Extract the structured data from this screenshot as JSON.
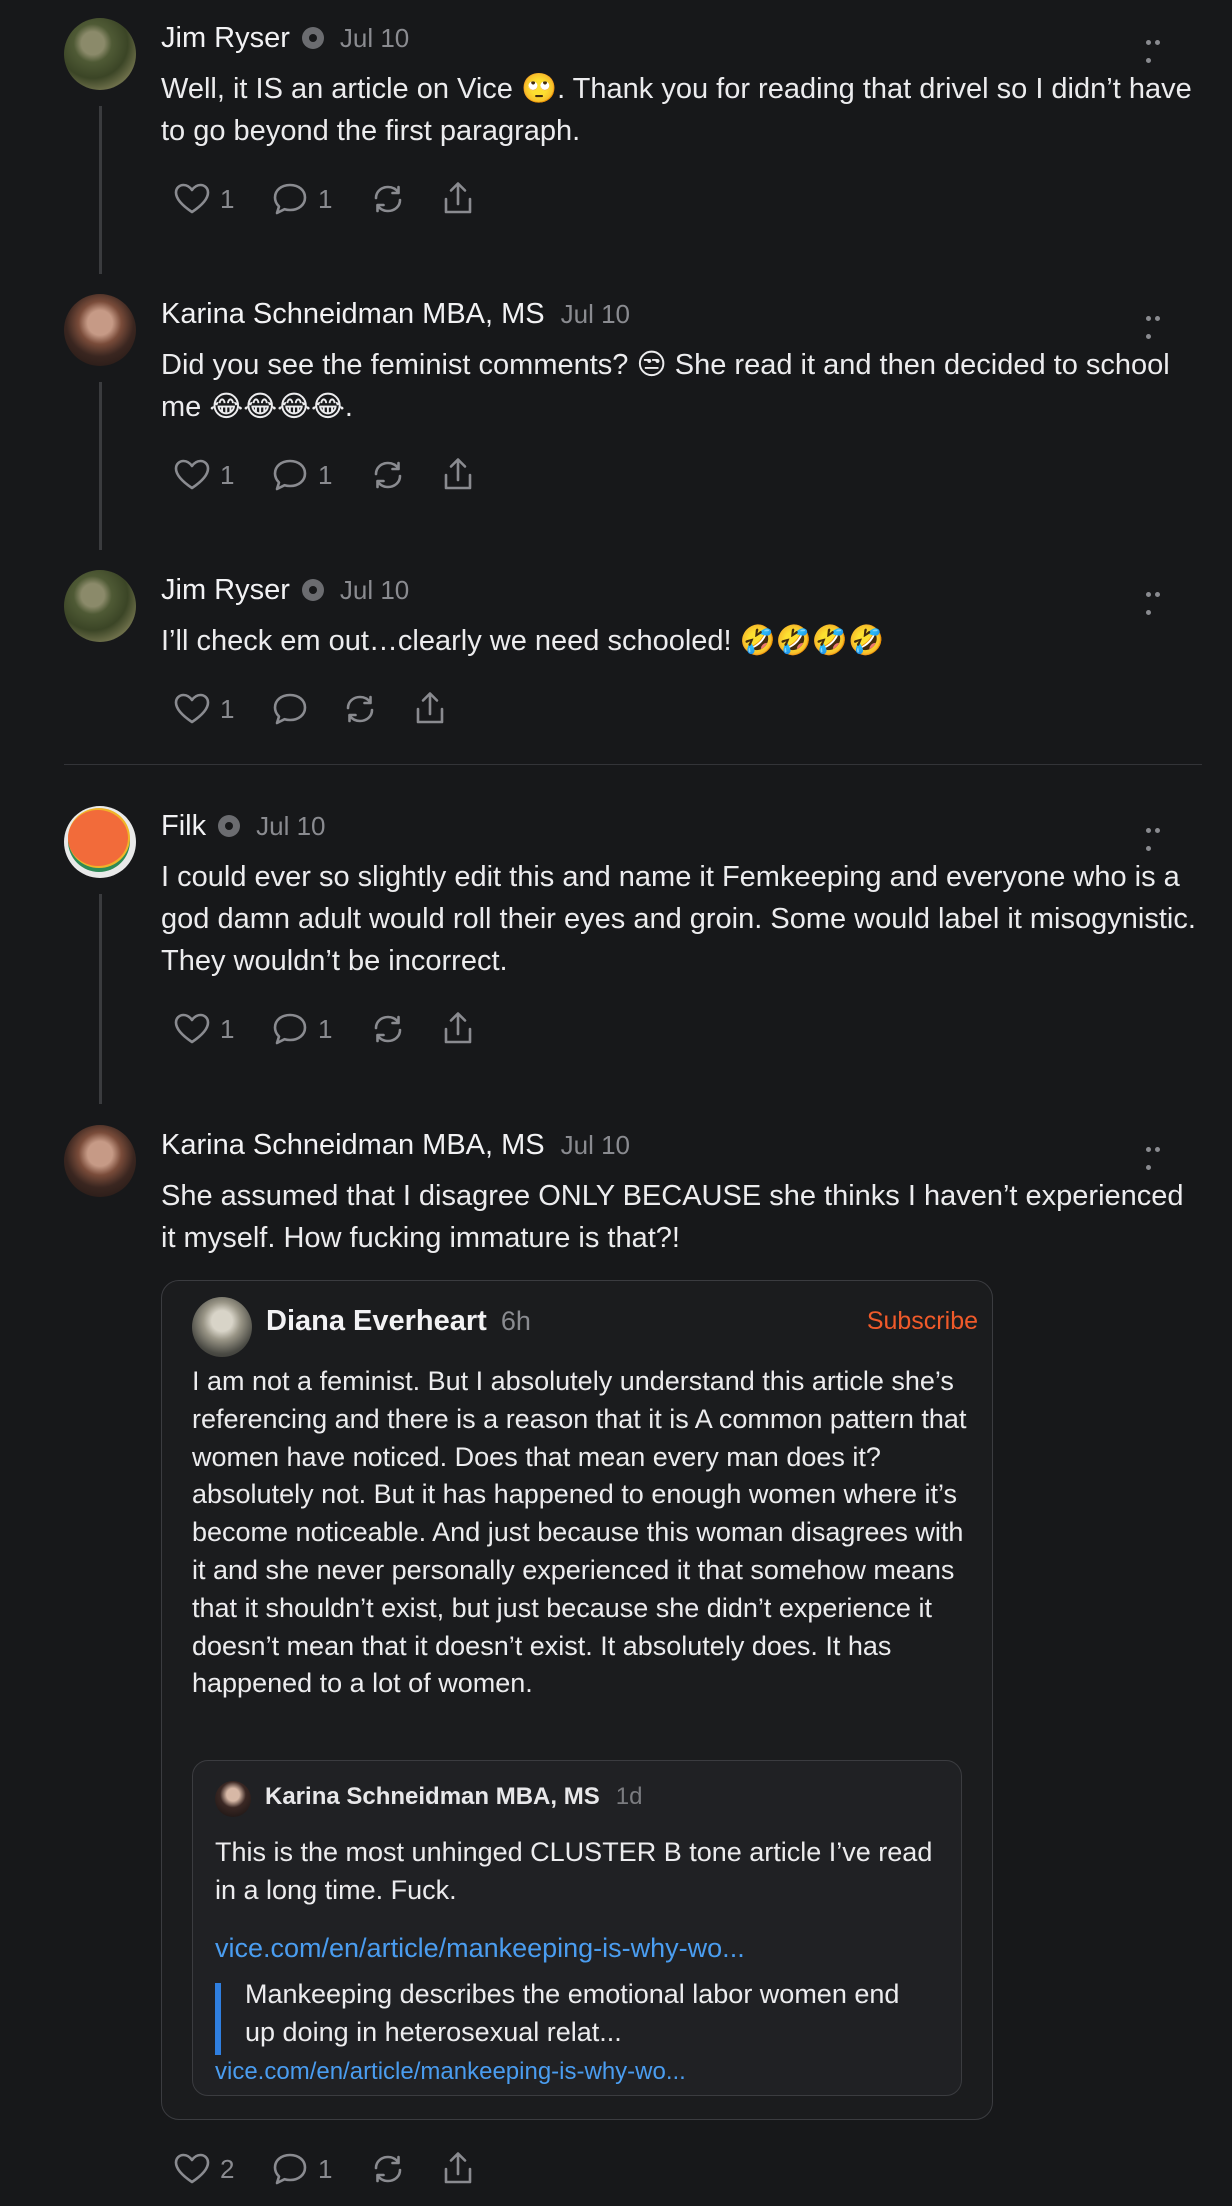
{
  "posts": [
    {
      "name": "Jim Ryser",
      "date": "Jul 10",
      "text": "Well, it IS an article on Vice 🙄. Thank you for reading that drivel so I didn’t have to go beyond the first paragraph.",
      "likes": "1",
      "replies": "1"
    },
    {
      "name": "Karina Schneidman MBA, MS",
      "date": "Jul 10",
      "text": "Did you see the feminist comments? 😒 She read it and then decided to school me 😂😂😂😂.",
      "likes": "1",
      "replies": "1"
    },
    {
      "name": "Jim Ryser",
      "date": "Jul 10",
      "text": "I’ll check em out…clearly we need schooled! 🤣🤣🤣🤣",
      "likes": "1",
      "replies": ""
    },
    {
      "name": "Filk",
      "date": "Jul 10",
      "text": "I could ever so slightly edit this and name it Femkeeping and everyone who is a god damn adult would roll their eyes and groin. Some would label it misogynistic. They wouldn’t be incorrect.",
      "likes": "1",
      "replies": "1"
    },
    {
      "name": "Karina Schneidman MBA, MS",
      "date": "Jul 10",
      "text": "She assumed that I disagree ONLY BECAUSE she thinks I haven’t experienced it myself. How fucking immature is that?!",
      "likes": "2",
      "replies": "1"
    }
  ],
  "quote": {
    "name": "Diana Everheart",
    "date": "6h",
    "subscribe": "Subscribe",
    "text": "I am not a feminist. But I absolutely understand this article she’s referencing and there is a reason that it is A common pattern that women have noticed. Does that mean every man does it? absolutely not. But it has happened to enough women where it’s become noticeable. And just because this woman disagrees with it and she never personally experienced it that somehow means that it shouldn’t exist, but just because she didn’t experience it doesn’t mean that it doesn’t exist. It absolutely does. It has happened to a lot of women.",
    "inner": {
      "name": "Karina Schneidman MBA, MS",
      "date": "1d",
      "text": "This is the most unhinged CLUSTER B tone article I’ve read in a long time. Fuck.",
      "link": "vice.com/en/article/mankeeping-is-why-wo...",
      "preview": "Mankeeping describes the emotional labor women end up doing in heterosexual relat...",
      "preview_link": "vice.com/en/article/mankeeping-is-why-wo..."
    }
  },
  "icons": [
    "heart-icon",
    "comment-icon",
    "repost-icon",
    "share-icon",
    "more-icon",
    "verified-badge-icon"
  ]
}
